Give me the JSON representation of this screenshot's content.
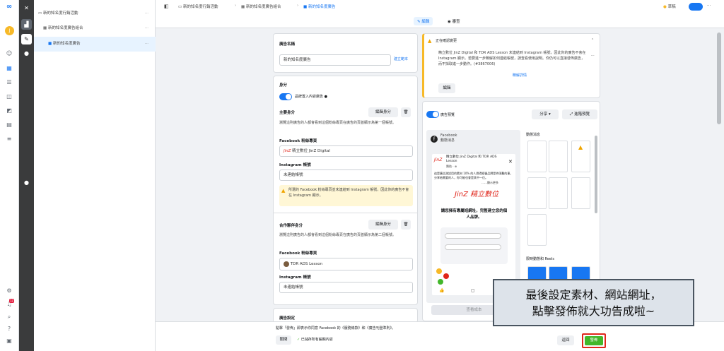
{
  "rail": {
    "icons": [
      "meta-logo",
      "avatar",
      "emoji-icon",
      "table-icon",
      "sliders-icon",
      "chart-icon",
      "layers-icon",
      "documents-icon",
      "list-icon",
      "settings-icon",
      "bell-icon",
      "search-icon",
      "help-icon",
      "report-icon"
    ],
    "avatar_letter": "J",
    "bell_badge": "12"
  },
  "tree": {
    "campaign": "新的知名度行銷活動",
    "adset": "新的知名度廣告組合",
    "ad": "新的知名度廣告"
  },
  "breadcrumb": {
    "campaign": "新的知名度行銷活動",
    "adset": "新的知名度廣告組合",
    "ad": "新的知名度廣告",
    "draft": "草稿"
  },
  "tabs": {
    "edit": "編輯",
    "review": "審查"
  },
  "ad_name": {
    "label": "廣告名稱",
    "value": "新的知名度廣告",
    "create_template": "建立範本"
  },
  "identity": {
    "title": "身分",
    "toggle_label": "品牌置入內容廣告",
    "primary": {
      "title": "主要身分",
      "edit": "編輯身分",
      "desc": "瀏覽這則廣告的人都會看到這個粉絲專頁在廣告的頁首顯示為第一個帳號。",
      "fb_label": "Facebook 粉絲專頁",
      "fb_value": "精立數位 JinZ Digital",
      "ig_label": "Instagram 帳號",
      "ig_value": "未連結帳號",
      "warning": "所選的 Facebook 粉絲專頁並未連結到 Instagram 帳號，因此你的廣告不會在 Instagram 顯示。"
    },
    "partner": {
      "title": "合作夥伴身分",
      "edit": "編輯身分",
      "desc": "瀏覽這則廣告的人都會看到這個粉絲專頁在廣告的頁首顯示為第二個帳號。",
      "fb_label": "Facebook 粉絲專頁",
      "fb_value": "TDR ADS Lesson",
      "ig_label": "Instagram 帳號",
      "ig_value": "未連結帳號"
    }
  },
  "ad_settings": {
    "title": "廣告設定"
  },
  "notice": {
    "title": "正在確認變更",
    "body": "精立數位 JinZ Digital 和 TDR ADS Lesson 未連結到 Instagram 帳號，因此你的廣告不會在 Instagram 顯示。若要進一步瞭解如何連結帳號，請查看使用說明。你仍可以直接發佈廣告，而不採取進一步動作。(#3867006)",
    "link": "瞭解詳情",
    "button": "編輯"
  },
  "preview": {
    "toggle_label": "廣告預覽",
    "share": "分享",
    "advanced": "進階預覽",
    "platform": "Facebook",
    "placement": "動態消息",
    "page_name": "精立數位 JinZ Digital 和 TDR ADS Lesson",
    "sponsored": "贊助 · ⊕",
    "post_text": "這是廣告測試用的素材 10% 的人覺得經營品牌是件困難的事，分享給需要的人，你可能也會是其中一位。",
    "see_more": "……顯示更多",
    "brand": "JinZ 精立數位",
    "headline": "讓您擁有專屬短網址，完整建立您的個人品牌。",
    "right_feed": "動態消息",
    "right_reels": "限時動態和 Reels",
    "bottom_btn": "查看成本"
  },
  "bottom": {
    "terms": "點擊「發佈」即表示你同意 Facebook 的《服務條款》和《廣告刊登準則》。",
    "close": "關閉",
    "saved": "已儲存所有編輯內容",
    "back": "返回",
    "publish": "發佈"
  },
  "callout": {
    "line1": "最後設定素材、網站網址，",
    "line2": "點擊發佈就大功告成啦~"
  },
  "colors": {
    "accent": "#1877f2",
    "publish_green": "#42b72a",
    "publish_border": "#e0261b",
    "warning_bg": "#fff7d6"
  }
}
